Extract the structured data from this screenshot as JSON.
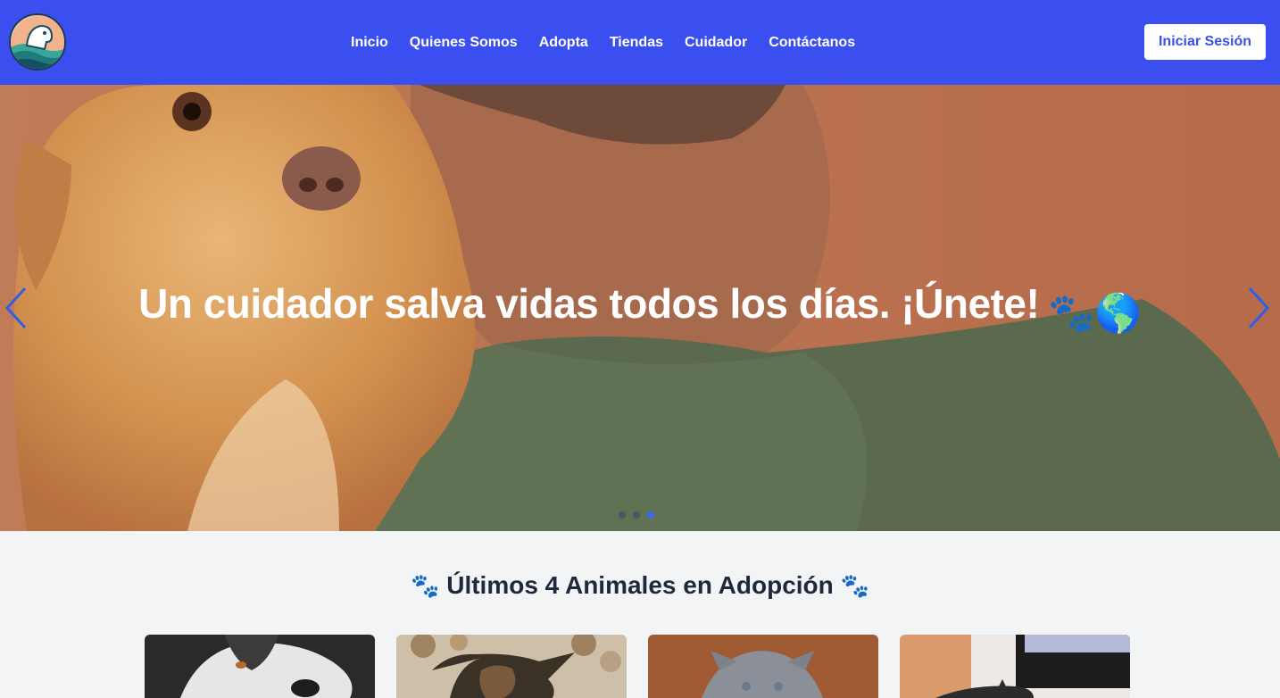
{
  "nav": {
    "logo": "logo-icon",
    "links": [
      {
        "label": "Inicio"
      },
      {
        "label": "Quienes Somos"
      },
      {
        "label": "Adopta"
      },
      {
        "label": "Tiendas"
      },
      {
        "label": "Cuidador"
      },
      {
        "label": "Contáctanos"
      }
    ],
    "login_label": "Iniciar Sesión"
  },
  "hero": {
    "caption": "Un cuidador salva vidas todos los días. ¡Únete!",
    "caption_emoji": "🐾🌎",
    "slides_total": 3,
    "active_slide": 3,
    "prev_icon": "chevron-left-icon",
    "next_icon": "chevron-right-icon"
  },
  "section": {
    "title": "Últimos 4 Animales en Adopción",
    "title_emoji": "🐾",
    "cards": [
      {
        "image": "husky-dog-photo"
      },
      {
        "image": "puppy-photo"
      },
      {
        "image": "gray-kitten-photo"
      },
      {
        "image": "cat-at-computer-photo"
      }
    ]
  },
  "colors": {
    "navbar": "#3b4ff0",
    "accent": "#3b6cf0",
    "page_bg": "#f3f4f6",
    "title": "#1e293b"
  }
}
